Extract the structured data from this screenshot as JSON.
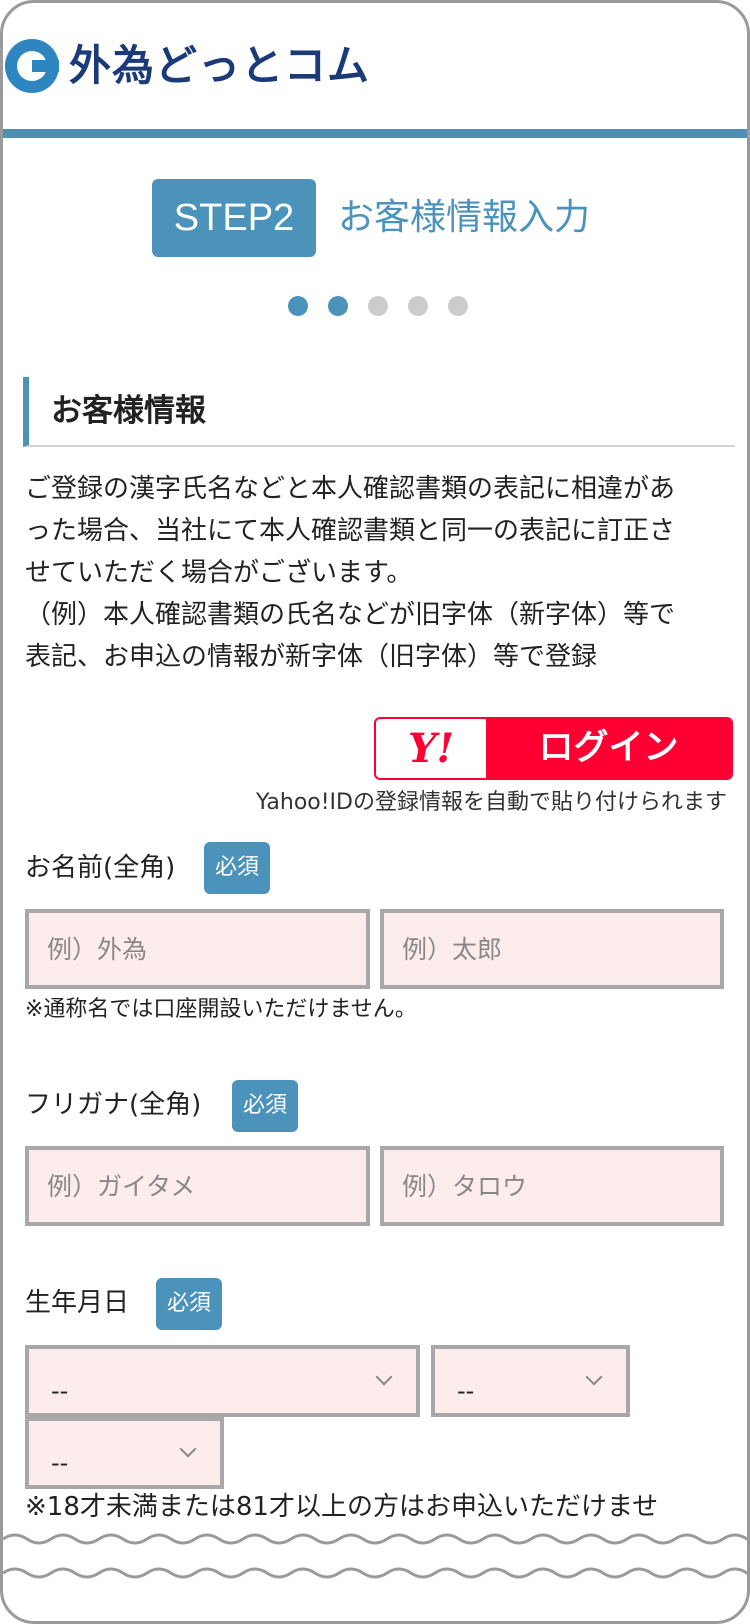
{
  "header": {
    "logo_text": "外為どっとコム"
  },
  "step": {
    "badge": "STEP2",
    "title": "お客様情報入力",
    "dots_total": 5,
    "dots_active": 2
  },
  "section": {
    "title": "お客様情報",
    "notice_lines": [
      "ご登録の漢字氏名などと本人確認書類の表記に相違があ",
      "った場合、当社にて本人確認書類と同一の表記に訂正さ",
      "せていただく場合がございます。",
      "（例）本人確認書類の氏名などが旧字体（新字体）等で",
      "表記、お申込の情報が新字体（旧字体）等で登録"
    ]
  },
  "yahoo": {
    "logo": "Y!",
    "login_label": "ログイン",
    "note": "Yahoo!IDの登録情報を自動で貼り付けられます"
  },
  "fields": {
    "required_label": "必須",
    "name": {
      "label": "お名前(全角)",
      "last_placeholder": "例）外為",
      "first_placeholder": "例）太郎",
      "hint": "※通称名では口座開設いただけません。"
    },
    "kana": {
      "label": "フリガナ(全角)",
      "last_placeholder": "例）ガイタメ",
      "first_placeholder": "例）タロウ"
    },
    "birthdate": {
      "label": "生年月日",
      "year_value": "--",
      "month_value": "--",
      "day_value": "--",
      "note": "※18才未満または81才以上の方はお申込いただけませ"
    }
  },
  "colors": {
    "accent": "#4b93bb",
    "logo_blue": "#1b3a7a",
    "yahoo_red": "#ff0033",
    "input_bg": "#fcecec"
  }
}
